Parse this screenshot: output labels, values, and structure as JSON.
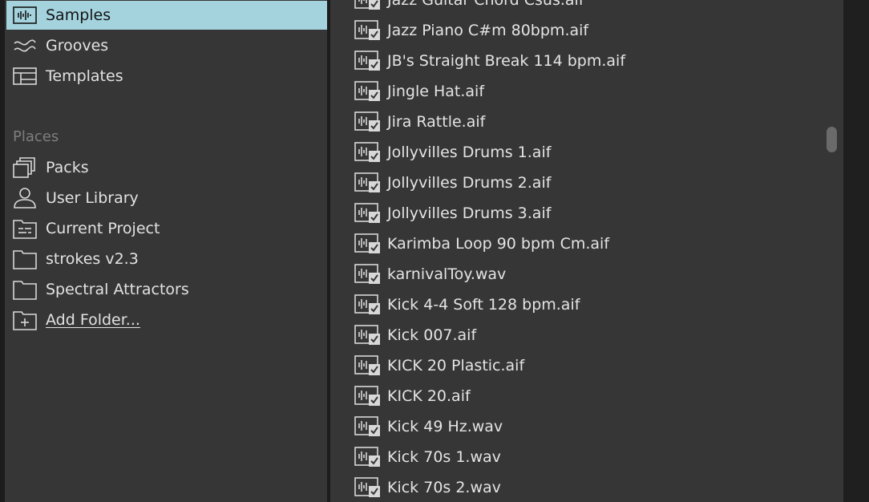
{
  "sidebar": {
    "items": [
      {
        "label": "Samples",
        "icon": "waveform-icon",
        "selected": true
      },
      {
        "label": "Grooves",
        "icon": "groove-wave-icon"
      },
      {
        "label": "Templates",
        "icon": "template-icon"
      }
    ],
    "places_header": "Places",
    "places": [
      {
        "label": "Packs",
        "icon": "packs-icon"
      },
      {
        "label": "User Library",
        "icon": "user-icon"
      },
      {
        "label": "Current Project",
        "icon": "project-folder-icon"
      },
      {
        "label": "strokes v2.3",
        "icon": "folder-icon"
      },
      {
        "label": "Spectral Attractors",
        "icon": "folder-icon"
      },
      {
        "label": "Add Folder...",
        "icon": "add-folder-icon"
      }
    ]
  },
  "files": [
    "Jazz Guitar Chord Csus.aif",
    "Jazz Piano C#m 80bpm.aif",
    "JB's Straight Break 114 bpm.aif",
    "Jingle Hat.aif",
    "Jira Rattle.aif",
    "Jollyvilles Drums 1.aif",
    "Jollyvilles Drums 2.aif",
    "Jollyvilles Drums 3.aif",
    "Karimba Loop 90 bpm Cm.aif",
    "karnivalToy.wav",
    "Kick 4-4 Soft 128 bpm.aif",
    "Kick 007.aif",
    "KICK 20 Plastic.aif",
    "KICK 20.aif",
    "Kick 49 Hz.wav",
    "Kick 70s 1.wav",
    "Kick 70s 2.wav"
  ],
  "file_icon": "sample-file-icon",
  "colors": {
    "selected_bg": "#a4d3de",
    "panel_bg": "#363636",
    "text": "#e2e2e2",
    "muted": "#7e7e7e"
  }
}
